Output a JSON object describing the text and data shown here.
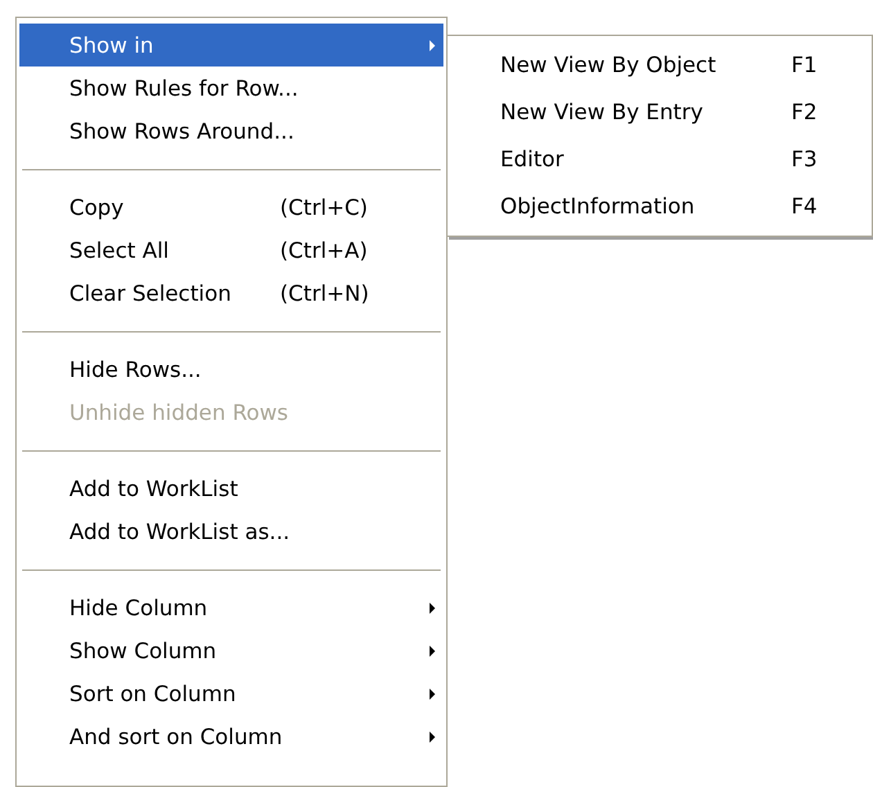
{
  "menu": {
    "items": [
      {
        "kind": "item",
        "label": "Show in",
        "selected": true,
        "disabled": false,
        "submenu": true
      },
      {
        "kind": "item",
        "label": "Show Rules for Row...",
        "selected": false,
        "disabled": false,
        "submenu": false
      },
      {
        "kind": "item",
        "label": "Show Rows Around...",
        "selected": false,
        "disabled": false,
        "submenu": false
      },
      {
        "kind": "separator"
      },
      {
        "kind": "item",
        "label": "Copy",
        "shortcut": "(Ctrl+C)",
        "selected": false,
        "disabled": false,
        "submenu": false
      },
      {
        "kind": "item",
        "label": "Select All",
        "shortcut": "(Ctrl+A)",
        "selected": false,
        "disabled": false,
        "submenu": false
      },
      {
        "kind": "item",
        "label": "Clear Selection",
        "shortcut": "(Ctrl+N)",
        "selected": false,
        "disabled": false,
        "submenu": false
      },
      {
        "kind": "separator"
      },
      {
        "kind": "item",
        "label": "Hide Rows...",
        "selected": false,
        "disabled": false,
        "submenu": false
      },
      {
        "kind": "item",
        "label": "Unhide hidden Rows",
        "selected": false,
        "disabled": true,
        "submenu": false
      },
      {
        "kind": "separator"
      },
      {
        "kind": "item",
        "label": "Add to WorkList",
        "selected": false,
        "disabled": false,
        "submenu": false
      },
      {
        "kind": "item",
        "label": "Add to WorkList as...",
        "selected": false,
        "disabled": false,
        "submenu": false
      },
      {
        "kind": "separator"
      },
      {
        "kind": "item",
        "label": "Hide Column",
        "selected": false,
        "disabled": false,
        "submenu": true
      },
      {
        "kind": "item",
        "label": "Show Column",
        "selected": false,
        "disabled": false,
        "submenu": true
      },
      {
        "kind": "item",
        "label": "Sort on Column",
        "selected": false,
        "disabled": false,
        "submenu": true
      },
      {
        "kind": "item",
        "label": "And sort on Column",
        "selected": false,
        "disabled": false,
        "submenu": true
      }
    ]
  },
  "submenu": {
    "items": [
      {
        "kind": "item",
        "label": "New View By Object",
        "shortcut": "F1",
        "selected": false,
        "disabled": false,
        "submenu": false
      },
      {
        "kind": "item",
        "label": "New View By Entry",
        "shortcut": "F2",
        "selected": false,
        "disabled": false,
        "submenu": false
      },
      {
        "kind": "item",
        "label": "Editor",
        "shortcut": "F3",
        "selected": false,
        "disabled": false,
        "submenu": false
      },
      {
        "kind": "item",
        "label": "ObjectInformation",
        "shortcut": "F4",
        "selected": false,
        "disabled": false,
        "submenu": false
      }
    ]
  }
}
